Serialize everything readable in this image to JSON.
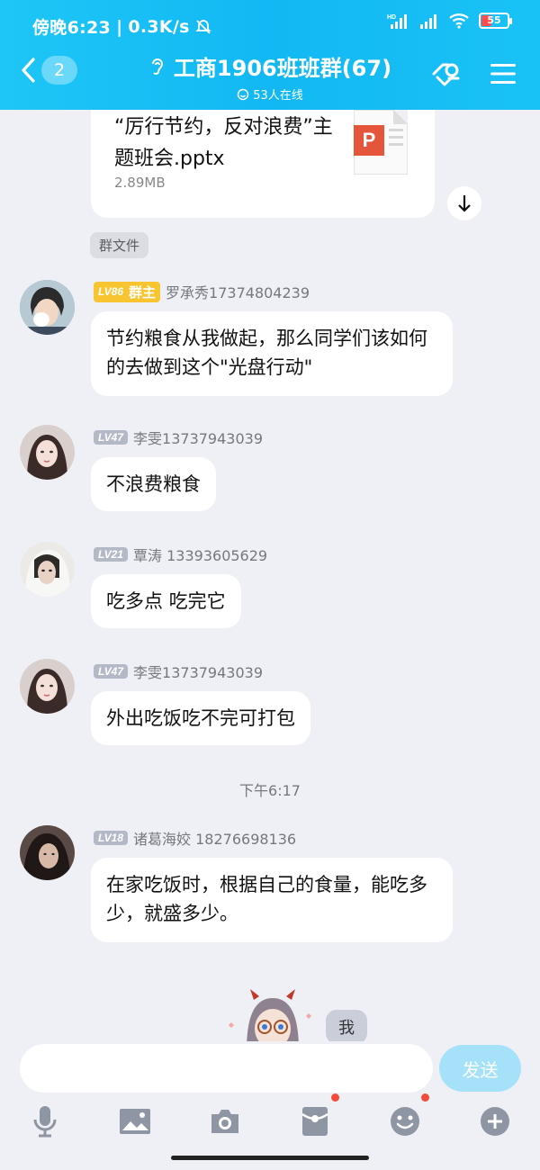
{
  "status": {
    "time": "傍晚6:23",
    "speed": "0.3K/s",
    "battery": "55"
  },
  "header": {
    "back_count": "2",
    "title": "工商1906班班群(67)",
    "online": "53人在线"
  },
  "file": {
    "name": "“厉行节约，反对浪费”主题班会.pptx",
    "size": "2.89MB",
    "tag": "群文件"
  },
  "messages": [
    {
      "level": "LV86",
      "role": "群主",
      "sender": "罗承秀17374804239",
      "text": "节约粮食从我做起，那么同学们该如何的去做到这个\"光盘行动\""
    },
    {
      "level": "LV47",
      "sender": "李雯13737943039",
      "text": "不浪费粮食"
    },
    {
      "level": "LV21",
      "sender": "覃涛 13393605629",
      "text": "吃多点 吃完它"
    },
    {
      "level": "LV47",
      "sender": "李雯13737943039",
      "text": "外出吃饭吃不完可打包"
    },
    {
      "level": "LV18",
      "sender": "诸葛海姣 18276698136",
      "text": "在家吃饭时，根据自己的食量，能吃多少，就盛多少。"
    }
  ],
  "timestamp": "下午6:17",
  "self_message": "我",
  "input": {
    "placeholder": "",
    "send_label": "发送"
  },
  "colors": {
    "header": "#12b8f3",
    "background": "#eff0f5",
    "owner_badge": "#f8c531",
    "send_disabled": "#a5e2fa"
  }
}
